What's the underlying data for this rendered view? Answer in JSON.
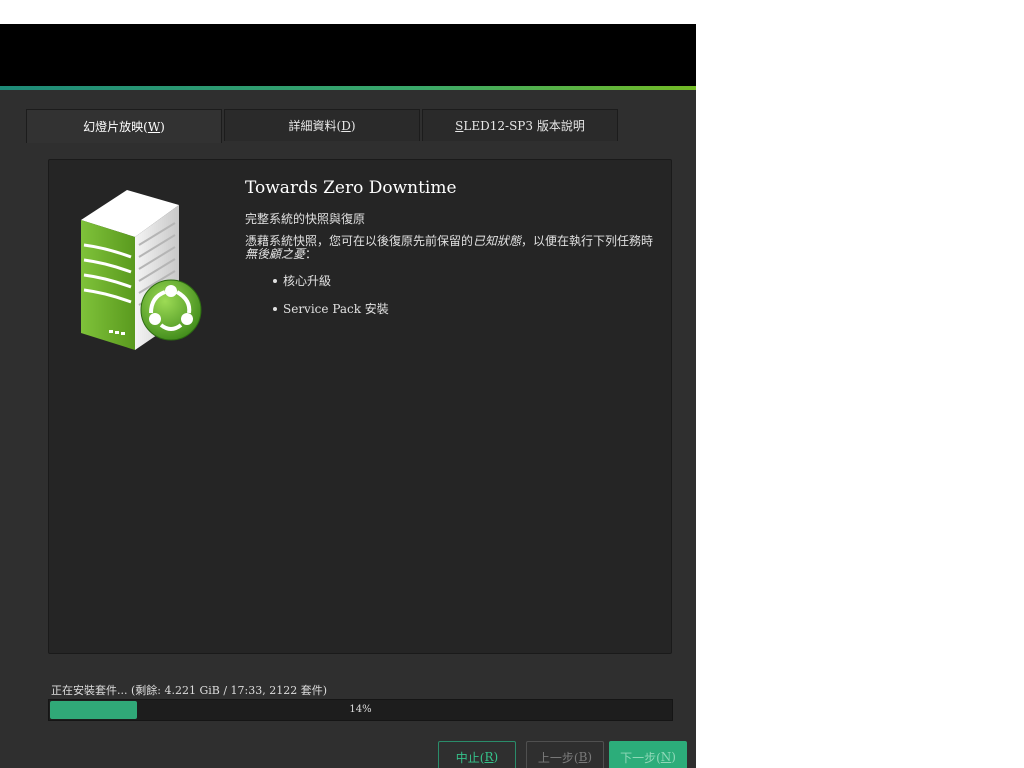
{
  "tabs": [
    {
      "label_prefix": "幻燈片放映(",
      "key": "W",
      "label_suffix": ")",
      "active": true
    },
    {
      "label_prefix": "詳細資料(",
      "key": "D",
      "label_suffix": ")",
      "active": false
    },
    {
      "label_prefix": "",
      "key": "S",
      "label_suffix": "LED12-SP3 版本說明",
      "active": false
    }
  ],
  "slide": {
    "title": "Towards Zero Downtime",
    "subtitle": "完整系統的快照與復原",
    "desc_part1": "憑藉系統快照，您可在以後復原先前保留的",
    "desc_em1": "已知狀態",
    "desc_part2": "，以便在執行下列任務時",
    "desc_em2": "無後顧之憂",
    "desc_part3": "：",
    "bullets": [
      "核心升級",
      "Service Pack 安裝"
    ]
  },
  "status": {
    "text": "正在安裝套件... (剩餘: 4.221 GiB / 17:33, 2122 套件)",
    "progress_percent": 14,
    "progress_label": "14%"
  },
  "buttons": {
    "abort_prefix": "中止(",
    "abort_key": "R",
    "abort_suffix": ")",
    "back_prefix": "上一步(",
    "back_key": "B",
    "back_suffix": ")",
    "next_prefix": "下一步(",
    "next_key": "N",
    "next_suffix": ")"
  },
  "colors": {
    "accent": "#30a878",
    "background": "#2f2f2f",
    "header": "#000000"
  }
}
